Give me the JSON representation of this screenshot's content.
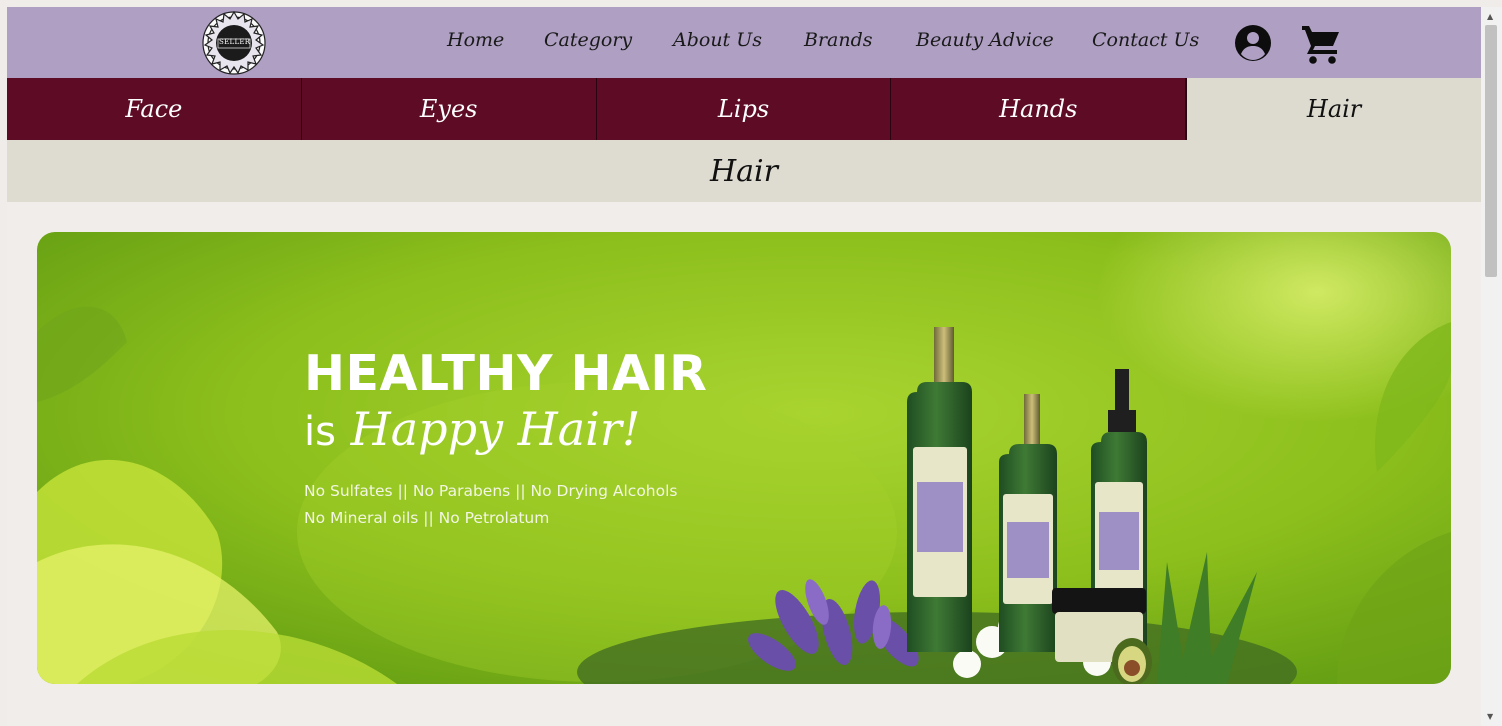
{
  "nav": {
    "logo_text": "SELLER",
    "links": [
      "Home",
      "Category",
      "About Us",
      "Brands",
      "Beauty Advice",
      "Contact Us"
    ],
    "icons": [
      "user-icon",
      "cart-icon"
    ]
  },
  "categories": [
    "Face",
    "Eyes",
    "Lips",
    "Hands",
    "Hair"
  ],
  "active_category": "Hair",
  "section_title": "Hair",
  "banner": {
    "headline": "HEALTHY HAIR",
    "sub_is": "is",
    "sub_happy": "Happy Hair!",
    "line1": "No Sulfates || No Parabens || No Drying Alcohols",
    "line2": "No Mineral oils || No Petrolatum"
  },
  "colors": {
    "nav_bg": "#ae9fc3",
    "category_bg": "#5e0b25",
    "active_bg": "#dddad0",
    "banner_green": "#8fc31c"
  }
}
